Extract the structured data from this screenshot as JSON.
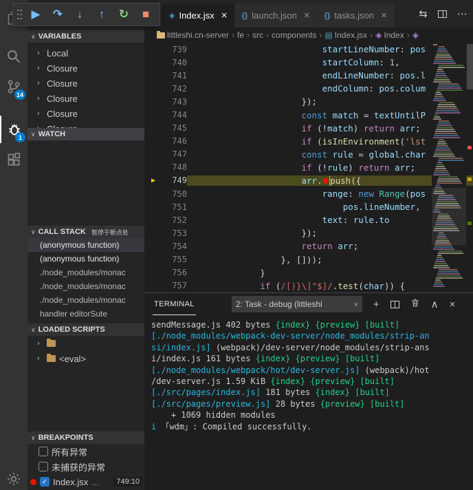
{
  "activity_bar": {
    "items": [
      {
        "name": "explorer",
        "badge": ""
      },
      {
        "name": "search",
        "badge": ""
      },
      {
        "name": "source-control",
        "badge": "14"
      },
      {
        "name": "run-and-debug",
        "badge": "1",
        "active": true
      },
      {
        "name": "extensions",
        "badge": ""
      }
    ]
  },
  "debug_toolbar": {
    "buttons": [
      {
        "name": "continue",
        "glyph": "▶",
        "color": "#75beff"
      },
      {
        "name": "step-over",
        "glyph": "↷",
        "color": "#75beff"
      },
      {
        "name": "step-into",
        "glyph": "↓",
        "color": "#75beff"
      },
      {
        "name": "step-out",
        "glyph": "↑",
        "color": "#75beff"
      },
      {
        "name": "restart",
        "glyph": "↻",
        "color": "#89d185"
      },
      {
        "name": "stop",
        "glyph": "■",
        "color": "#f48771"
      }
    ]
  },
  "tabs": [
    {
      "label": "Index.jsx",
      "icon_glyph": "◈",
      "icon_color": "#519aba",
      "active": true
    },
    {
      "label": "launch.json",
      "icon_glyph": "{}",
      "icon_color": "#519aba",
      "active": false
    },
    {
      "label": "tasks.json",
      "icon_glyph": "{}",
      "icon_color": "#519aba",
      "active": false
    }
  ],
  "editor_actions": [
    {
      "name": "toggle-layout",
      "glyph": "⇆"
    },
    {
      "name": "split-editor",
      "glyph": "split"
    },
    {
      "name": "more-actions",
      "glyph": "⋯"
    }
  ],
  "breadcrumbs": [
    {
      "label": "littleshi.cn-server",
      "icon": "folder"
    },
    {
      "label": "fe"
    },
    {
      "label": "src"
    },
    {
      "label": "components"
    },
    {
      "label": "Index.jsx",
      "icon": "file"
    },
    {
      "label": "Index",
      "icon": "symbol"
    },
    {
      "label": "",
      "icon": "symbol"
    }
  ],
  "sidebar": {
    "variables": {
      "title": "VARIABLES",
      "items": [
        {
          "label": "Local"
        },
        {
          "label": "Closure"
        },
        {
          "label": "Closure"
        },
        {
          "label": "Closure"
        },
        {
          "label": "Closure"
        },
        {
          "label": "Closure"
        }
      ]
    },
    "watch": {
      "title": "WATCH"
    },
    "call_stack": {
      "title": "CALL STACK",
      "badge": "暂停于断点处",
      "items": [
        {
          "label": "(anonymous function)",
          "selected": true,
          "emph": true
        },
        {
          "label": "(anonymous function)",
          "emph": true
        },
        {
          "label": "./node_modules/monac"
        },
        {
          "label": "./node_modules/monac"
        },
        {
          "label": "./node_modules/monac"
        },
        {
          "label": "handler  editorSute"
        }
      ]
    },
    "loaded_scripts": {
      "title": "LOADED SCRIPTS",
      "items": [
        {
          "label": ""
        },
        {
          "label": "<eval>"
        }
      ]
    },
    "breakpoints": {
      "title": "BREAKPOINTS",
      "items": [
        {
          "label": "所有异常",
          "checked": false,
          "dot": false,
          "detail": "",
          "location": ""
        },
        {
          "label": "未捕获的异常",
          "checked": false,
          "dot": false,
          "detail": "",
          "location": ""
        },
        {
          "label": "Index.jsx",
          "checked": true,
          "dot": true,
          "detail": "...",
          "location": "749:10"
        }
      ]
    }
  },
  "editor": {
    "current_line": 749,
    "lines": [
      {
        "num": 739,
        "ind": 24,
        "seg": [
          [
            "var",
            "startLineNumber"
          ],
          [
            "pun",
            ": "
          ],
          [
            "var",
            "pos"
          ]
        ]
      },
      {
        "num": 740,
        "ind": 24,
        "seg": [
          [
            "var",
            "startColumn"
          ],
          [
            "pun",
            ": "
          ],
          [
            "num",
            "1"
          ],
          [
            "pun",
            ","
          ]
        ]
      },
      {
        "num": 741,
        "ind": 24,
        "seg": [
          [
            "var",
            "endLineNumber"
          ],
          [
            "pun",
            ": "
          ],
          [
            "var",
            "pos"
          ],
          [
            "pun",
            "."
          ],
          [
            "var",
            "l"
          ]
        ]
      },
      {
        "num": 742,
        "ind": 24,
        "seg": [
          [
            "var",
            "endColumn"
          ],
          [
            "pun",
            ": "
          ],
          [
            "var",
            "pos"
          ],
          [
            "pun",
            "."
          ],
          [
            "var",
            "colum"
          ]
        ]
      },
      {
        "num": 743,
        "ind": 20,
        "seg": [
          [
            "pun",
            "});"
          ]
        ]
      },
      {
        "num": 744,
        "ind": 20,
        "seg": [
          [
            "kw",
            "const "
          ],
          [
            "var",
            "match"
          ],
          [
            "pun",
            " = "
          ],
          [
            "var",
            "textUntilP"
          ]
        ]
      },
      {
        "num": 745,
        "ind": 20,
        "seg": [
          [
            "ctrl",
            "if"
          ],
          [
            "pun",
            " (!"
          ],
          [
            "var",
            "match"
          ],
          [
            "pun",
            ") "
          ],
          [
            "ctrl",
            "return"
          ],
          [
            "pun",
            " "
          ],
          [
            "var",
            "arr"
          ],
          [
            "pun",
            ";"
          ]
        ]
      },
      {
        "num": 746,
        "ind": 20,
        "seg": [
          [
            "ctrl",
            "if"
          ],
          [
            "pun",
            " ("
          ],
          [
            "fn",
            "isInEnvironment"
          ],
          [
            "pun",
            "("
          ],
          [
            "str",
            "'lst"
          ]
        ]
      },
      {
        "num": 747,
        "ind": 20,
        "seg": [
          [
            "kw",
            "const "
          ],
          [
            "var",
            "rule"
          ],
          [
            "pun",
            " = "
          ],
          [
            "var",
            "global"
          ],
          [
            "pun",
            "."
          ],
          [
            "var",
            "char"
          ]
        ]
      },
      {
        "num": 748,
        "ind": 20,
        "seg": [
          [
            "ctrl",
            "if"
          ],
          [
            "pun",
            " (!"
          ],
          [
            "var",
            "rule"
          ],
          [
            "pun",
            ") "
          ],
          [
            "ctrl",
            "return"
          ],
          [
            "pun",
            " "
          ],
          [
            "var",
            "arr"
          ],
          [
            "pun",
            ";"
          ]
        ]
      },
      {
        "num": 749,
        "ind": 20,
        "seg": [
          [
            "var",
            "arr"
          ],
          [
            "pun",
            "."
          ],
          [
            "bp",
            ""
          ],
          [
            "caret",
            ""
          ],
          [
            "fn",
            "push"
          ],
          [
            "pun",
            "({"
          ]
        ]
      },
      {
        "num": 750,
        "ind": 24,
        "seg": [
          [
            "var",
            "range"
          ],
          [
            "pun",
            ": "
          ],
          [
            "kw",
            "new "
          ],
          [
            "cls",
            "Range"
          ],
          [
            "pun",
            "("
          ],
          [
            "var",
            "pos"
          ]
        ]
      },
      {
        "num": 751,
        "ind": 28,
        "seg": [
          [
            "var",
            "pos"
          ],
          [
            "pun",
            "."
          ],
          [
            "var",
            "lineNumber"
          ],
          [
            "pun",
            ","
          ]
        ]
      },
      {
        "num": 752,
        "ind": 24,
        "seg": [
          [
            "var",
            "text"
          ],
          [
            "pun",
            ": "
          ],
          [
            "var",
            "rule"
          ],
          [
            "pun",
            "."
          ],
          [
            "var",
            "to"
          ]
        ]
      },
      {
        "num": 753,
        "ind": 20,
        "seg": [
          [
            "pun",
            "});"
          ]
        ]
      },
      {
        "num": 754,
        "ind": 20,
        "seg": [
          [
            "ctrl",
            "return"
          ],
          [
            "pun",
            " "
          ],
          [
            "var",
            "arr"
          ],
          [
            "pun",
            ";"
          ]
        ]
      },
      {
        "num": 755,
        "ind": 16,
        "seg": [
          [
            "pun",
            "}, []));"
          ]
        ]
      },
      {
        "num": 756,
        "ind": 12,
        "seg": [
          [
            "pun",
            "}"
          ]
        ]
      },
      {
        "num": 757,
        "ind": 12,
        "seg": [
          [
            "ctrl",
            "if"
          ],
          [
            "pun",
            " ("
          ],
          [
            "rgx",
            "/[)}\\]\"$]/"
          ],
          [
            "pun",
            "."
          ],
          [
            "fn",
            "test"
          ],
          [
            "pun",
            "("
          ],
          [
            "var",
            "char"
          ],
          [
            "pun",
            ")) {"
          ]
        ]
      }
    ]
  },
  "terminal": {
    "tab_label": "TERMINAL",
    "dropdown_value": "2: Task - debug (littleshi",
    "dropdown_chevron": "∨",
    "lines": [
      [
        [
          "fg",
          "sendMessage.js 402 bytes "
        ],
        [
          "grn",
          "{index} {preview} [built]"
        ]
      ],
      [
        [
          "cyn",
          "[./node_modules/webpack-dev-server/node_modules/strip-an"
        ]
      ],
      [
        [
          "cyn",
          "si/index.js]"
        ],
        [
          "fg",
          " (webpack)/dev-server/node_modules/strip-ans"
        ]
      ],
      [
        [
          "fg",
          "i/index.js 161 bytes "
        ],
        [
          "grn",
          "{index} {preview} [built]"
        ]
      ],
      [
        [
          "cyn",
          "[./node_modules/webpack/hot/dev-server.js]"
        ],
        [
          "fg",
          " (webpack)/hot"
        ]
      ],
      [
        [
          "fg",
          "/dev-server.js 1.59 KiB "
        ],
        [
          "grn",
          "{index} {preview} [built]"
        ]
      ],
      [
        [
          "cyn",
          "[./src/pages/index.js]"
        ],
        [
          "fg",
          " 181 bytes "
        ],
        [
          "grn",
          "{index} [built]"
        ]
      ],
      [
        [
          "cyn",
          "[./src/pages/preview.js]"
        ],
        [
          "fg",
          " 28 bytes "
        ],
        [
          "grn",
          "{preview} [built]"
        ]
      ],
      [
        [
          "fg",
          "    + 1069 hidden modules"
        ]
      ],
      [
        [
          "cyn",
          "i"
        ],
        [
          "fg",
          " 「wdm」: Compiled successfully."
        ]
      ]
    ],
    "actions": [
      {
        "name": "new-terminal",
        "glyph": "+"
      },
      {
        "name": "split-terminal",
        "glyph": "split"
      },
      {
        "name": "kill-terminal",
        "glyph": "trash"
      },
      {
        "name": "maximize-panel",
        "glyph": "∧"
      },
      {
        "name": "close-panel",
        "glyph": "×"
      }
    ]
  }
}
